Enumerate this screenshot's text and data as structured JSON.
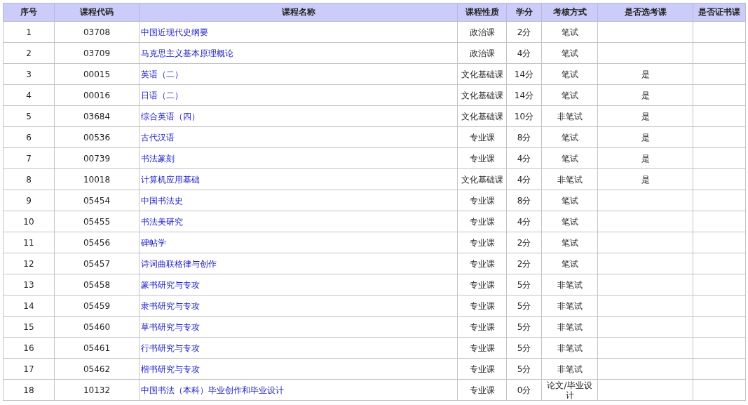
{
  "table": {
    "columns": [
      "序号",
      "课程代码",
      "课程名称",
      "课程性质",
      "学分",
      "考核方式",
      "是否选考课",
      "是否证书课"
    ],
    "rows": [
      {
        "no": "1",
        "code": "03708",
        "name": "中国近现代史纲要",
        "type": "政治课",
        "credits": "2分",
        "exam": "笔试"
      },
      {
        "no": "2",
        "code": "03709",
        "name": "马克思主义基本原理概论",
        "type": "政治课",
        "credits": "4分",
        "exam": "笔试"
      },
      {
        "no": "3",
        "code": "00015",
        "name": "英语（二）",
        "type": "文化基础课",
        "credits": "14分",
        "exam": "笔试",
        "elective": "是"
      },
      {
        "no": "4",
        "code": "00016",
        "name": "日语（二）",
        "type": "文化基础课",
        "credits": "14分",
        "exam": "笔试",
        "elective": "是"
      },
      {
        "no": "5",
        "code": "03684",
        "name": "综合英语（四）",
        "type": "文化基础课",
        "credits": "10分",
        "exam": "非笔试",
        "elective": "是"
      },
      {
        "no": "6",
        "code": "00536",
        "name": "古代汉语",
        "type": "专业课",
        "credits": "8分",
        "exam": "笔试",
        "elective": "是"
      },
      {
        "no": "7",
        "code": "00739",
        "name": "书法篆刻",
        "type": "专业课",
        "credits": "4分",
        "exam": "笔试",
        "elective": "是"
      },
      {
        "no": "8",
        "code": "10018",
        "name": "计算机应用基础",
        "type": "文化基础课",
        "credits": "4分",
        "exam": "非笔试",
        "elective": "是"
      },
      {
        "no": "9",
        "code": "05454",
        "name": "中国书法史",
        "type": "专业课",
        "credits": "8分",
        "exam": "笔试"
      },
      {
        "no": "10",
        "code": "05455",
        "name": "书法美研究",
        "type": "专业课",
        "credits": "4分",
        "exam": "笔试"
      },
      {
        "no": "11",
        "code": "05456",
        "name": "碑帖学",
        "type": "专业课",
        "credits": "2分",
        "exam": "笔试"
      },
      {
        "no": "12",
        "code": "05457",
        "name": "诗词曲联格律与创作",
        "type": "专业课",
        "credits": "2分",
        "exam": "笔试"
      },
      {
        "no": "13",
        "code": "05458",
        "name": "篆书研究与专攻",
        "type": "专业课",
        "credits": "5分",
        "exam": "非笔试"
      },
      {
        "no": "14",
        "code": "05459",
        "name": "隶书研究与专攻",
        "type": "专业课",
        "credits": "5分",
        "exam": "非笔试"
      },
      {
        "no": "15",
        "code": "05460",
        "name": "草书研究与专攻",
        "type": "专业课",
        "credits": "5分",
        "exam": "非笔试"
      },
      {
        "no": "16",
        "code": "05461",
        "name": "行书研究与专攻",
        "type": "专业课",
        "credits": "5分",
        "exam": "非笔试"
      },
      {
        "no": "17",
        "code": "05462",
        "name": "楷书研究与专攻",
        "type": "专业课",
        "credits": "5分",
        "exam": "非笔试"
      },
      {
        "no": "18",
        "code": "10132",
        "name": "中国书法（本科）毕业创作和毕业设计",
        "type": "专业课",
        "credits": "0分",
        "exam": "论文/毕业设计"
      }
    ]
  }
}
